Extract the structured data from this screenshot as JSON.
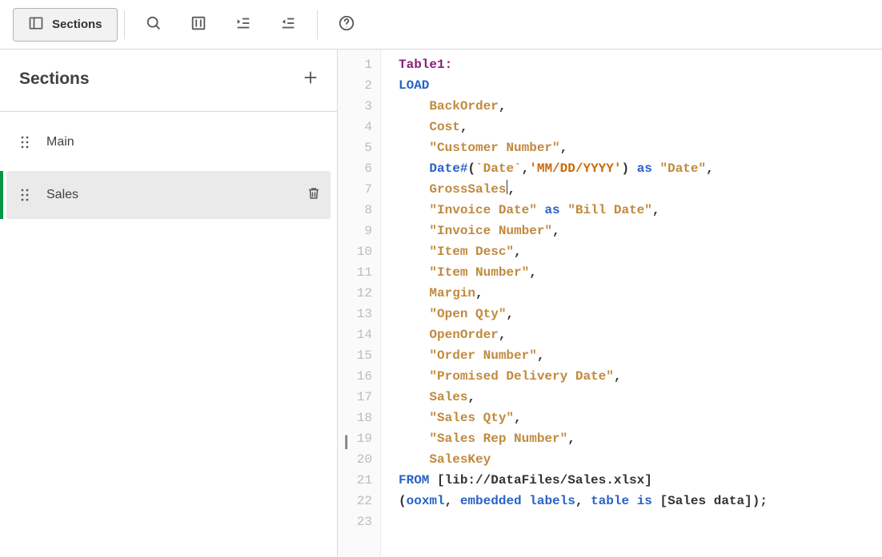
{
  "toolbar": {
    "sections_button_label": "Sections"
  },
  "sidebar": {
    "header": "Sections",
    "items": [
      {
        "label": "Main",
        "active": false
      },
      {
        "label": "Sales",
        "active": true
      }
    ]
  },
  "editor": {
    "lines": [
      [
        {
          "t": "label",
          "v": "Table1:"
        }
      ],
      [
        {
          "t": "keyword",
          "v": "LOAD"
        }
      ],
      [
        {
          "t": "indent",
          "v": "    "
        },
        {
          "t": "field",
          "v": "BackOrder"
        },
        {
          "t": "punct",
          "v": ","
        }
      ],
      [
        {
          "t": "indent",
          "v": "    "
        },
        {
          "t": "field",
          "v": "Cost"
        },
        {
          "t": "punct",
          "v": ","
        }
      ],
      [
        {
          "t": "indent",
          "v": "    "
        },
        {
          "t": "string",
          "v": "\"Customer Number\""
        },
        {
          "t": "punct",
          "v": ","
        }
      ],
      [
        {
          "t": "indent",
          "v": "    "
        },
        {
          "t": "func",
          "v": "Date#"
        },
        {
          "t": "punct",
          "v": "("
        },
        {
          "t": "field",
          "v": "`Date`"
        },
        {
          "t": "punct",
          "v": ","
        },
        {
          "t": "lit",
          "v": "'MM/DD/YYYY'"
        },
        {
          "t": "punct",
          "v": ")"
        },
        {
          "t": "space",
          "v": " "
        },
        {
          "t": "keyword",
          "v": "as"
        },
        {
          "t": "space",
          "v": " "
        },
        {
          "t": "string",
          "v": "\"Date\""
        },
        {
          "t": "punct",
          "v": ","
        }
      ],
      [
        {
          "t": "indent",
          "v": "    "
        },
        {
          "t": "field",
          "v": "GrossSales"
        },
        {
          "t": "cursor",
          "v": ""
        },
        {
          "t": "punct",
          "v": ","
        }
      ],
      [
        {
          "t": "indent",
          "v": "    "
        },
        {
          "t": "string",
          "v": "\"Invoice Date\""
        },
        {
          "t": "space",
          "v": " "
        },
        {
          "t": "keyword",
          "v": "as"
        },
        {
          "t": "space",
          "v": " "
        },
        {
          "t": "string",
          "v": "\"Bill Date\""
        },
        {
          "t": "punct",
          "v": ","
        }
      ],
      [
        {
          "t": "indent",
          "v": "    "
        },
        {
          "t": "string",
          "v": "\"Invoice Number\""
        },
        {
          "t": "punct",
          "v": ","
        }
      ],
      [
        {
          "t": "indent",
          "v": "    "
        },
        {
          "t": "string",
          "v": "\"Item Desc\""
        },
        {
          "t": "punct",
          "v": ","
        }
      ],
      [
        {
          "t": "indent",
          "v": "    "
        },
        {
          "t": "string",
          "v": "\"Item Number\""
        },
        {
          "t": "punct",
          "v": ","
        }
      ],
      [
        {
          "t": "indent",
          "v": "    "
        },
        {
          "t": "field",
          "v": "Margin"
        },
        {
          "t": "punct",
          "v": ","
        }
      ],
      [
        {
          "t": "indent",
          "v": "    "
        },
        {
          "t": "string",
          "v": "\"Open Qty\""
        },
        {
          "t": "punct",
          "v": ","
        }
      ],
      [
        {
          "t": "indent",
          "v": "    "
        },
        {
          "t": "field",
          "v": "OpenOrder"
        },
        {
          "t": "punct",
          "v": ","
        }
      ],
      [
        {
          "t": "indent",
          "v": "    "
        },
        {
          "t": "string",
          "v": "\"Order Number\""
        },
        {
          "t": "punct",
          "v": ","
        }
      ],
      [
        {
          "t": "indent",
          "v": "    "
        },
        {
          "t": "string",
          "v": "\"Promised Delivery Date\""
        },
        {
          "t": "punct",
          "v": ","
        }
      ],
      [
        {
          "t": "indent",
          "v": "    "
        },
        {
          "t": "field",
          "v": "Sales"
        },
        {
          "t": "punct",
          "v": ","
        }
      ],
      [
        {
          "t": "indent",
          "v": "    "
        },
        {
          "t": "string",
          "v": "\"Sales Qty\""
        },
        {
          "t": "punct",
          "v": ","
        }
      ],
      [
        {
          "t": "indent",
          "v": "    "
        },
        {
          "t": "string",
          "v": "\"Sales Rep Number\""
        },
        {
          "t": "punct",
          "v": ","
        }
      ],
      [
        {
          "t": "indent",
          "v": "    "
        },
        {
          "t": "field",
          "v": "SalesKey"
        }
      ],
      [
        {
          "t": "keyword",
          "v": "FROM"
        },
        {
          "t": "space",
          "v": " "
        },
        {
          "t": "path",
          "v": "[lib://DataFiles/Sales.xlsx]"
        }
      ],
      [
        {
          "t": "punct",
          "v": "("
        },
        {
          "t": "keyword",
          "v": "ooxml"
        },
        {
          "t": "punct",
          "v": ", "
        },
        {
          "t": "keyword",
          "v": "embedded labels"
        },
        {
          "t": "punct",
          "v": ", "
        },
        {
          "t": "keyword",
          "v": "table"
        },
        {
          "t": "space",
          "v": " "
        },
        {
          "t": "keyword",
          "v": "is"
        },
        {
          "t": "space",
          "v": " "
        },
        {
          "t": "path",
          "v": "[Sales data]"
        },
        {
          "t": "punct",
          "v": ");"
        }
      ],
      []
    ]
  }
}
